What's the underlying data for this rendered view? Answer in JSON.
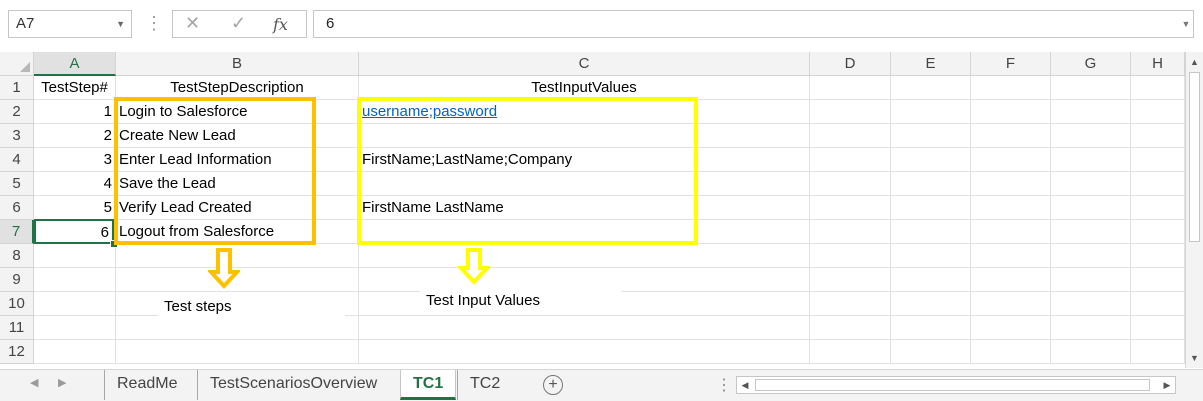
{
  "formula_bar": {
    "name_box": "A7",
    "cancel_glyph": "✕",
    "enter_glyph": "✓",
    "fx_glyph": "fx",
    "content": "6"
  },
  "columns": [
    "A",
    "B",
    "C",
    "D",
    "E",
    "F",
    "G",
    "H"
  ],
  "rows": [
    "1",
    "2",
    "3",
    "4",
    "5",
    "6",
    "7",
    "8",
    "9",
    "10",
    "11",
    "12"
  ],
  "cells": {
    "A1": "TestStep#",
    "B1": "TestStepDescription",
    "C1": "TestInputValues",
    "A2": "1",
    "B2": "Login to Salesforce",
    "C2": "username;password",
    "A3": "2",
    "B3": "Create New Lead",
    "A4": "3",
    "B4": "Enter Lead Information",
    "C4": "FirstName;LastName;Company",
    "A5": "4",
    "B5": "Save the Lead",
    "A6": "5",
    "B6": "Verify Lead Created",
    "C6": "FirstName LastName",
    "A7": "6",
    "B7": "Logout from Salesforce"
  },
  "annotations": {
    "test_steps_label": "Test steps",
    "test_input_label": "Test Input Values",
    "orange": "#ffc000",
    "yellow": "#ffff00"
  },
  "sheet_tabs": [
    {
      "label": "ReadMe",
      "active": false
    },
    {
      "label": "TestScenariosOverview",
      "active": false
    },
    {
      "label": "TC1",
      "active": true
    },
    {
      "label": "TC2",
      "active": false
    }
  ],
  "colors": {
    "excel_green": "#217346",
    "link": "#0563c1"
  }
}
